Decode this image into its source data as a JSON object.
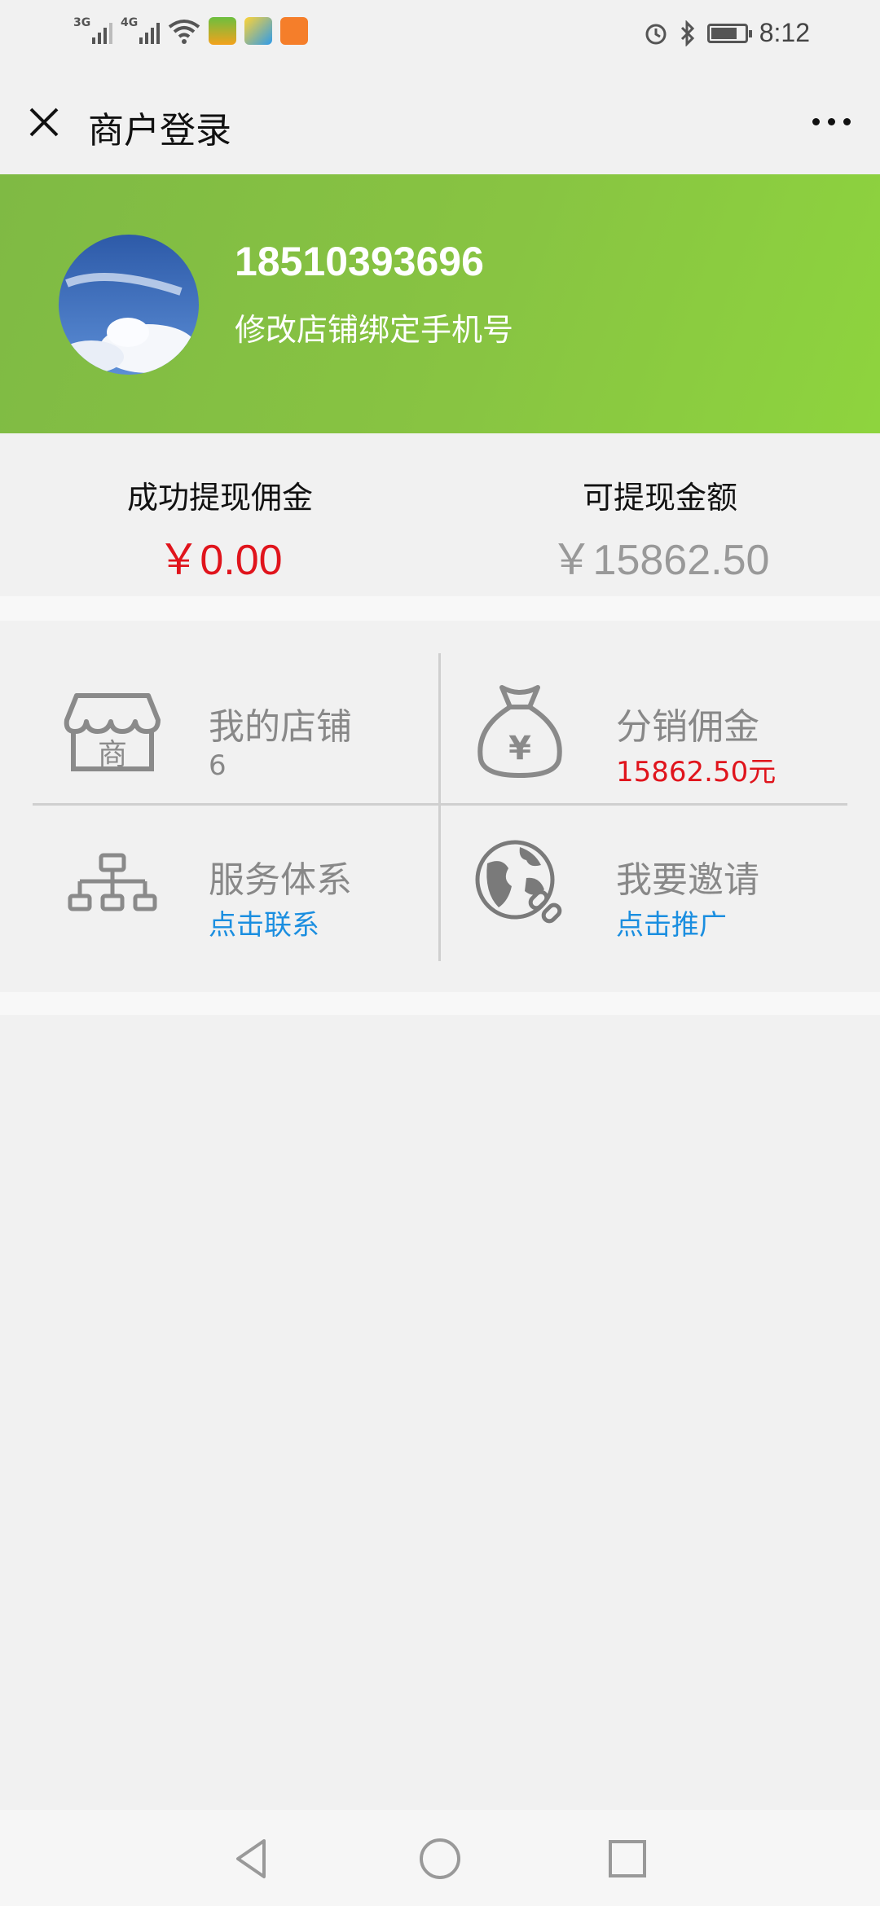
{
  "status_bar": {
    "net1": "3G",
    "net2": "4G",
    "time": "8:12",
    "battery_level": 0.72
  },
  "title_bar": {
    "title": "商户登录"
  },
  "profile": {
    "phone": "18510393696",
    "change_link": "修改店铺绑定手机号"
  },
  "balance": {
    "success_label": "成功提现佣金",
    "success_value": "￥0.00",
    "available_label": "可提现金额",
    "available_value": "￥15862.50"
  },
  "grid": [
    {
      "name": "我的店铺",
      "sub": "6",
      "icon": "store-icon"
    },
    {
      "name": "分销佣金",
      "sub": "15862.50元",
      "icon": "money-bag-icon"
    },
    {
      "name": "服务体系",
      "sub": "点击联系",
      "icon": "hierarchy-icon"
    },
    {
      "name": "我要邀请",
      "sub": "点击推广",
      "icon": "globe-link-icon"
    }
  ],
  "colors": {
    "banner_green": "#88c442",
    "red": "#e0141c",
    "link_blue": "#1a8ee0"
  }
}
